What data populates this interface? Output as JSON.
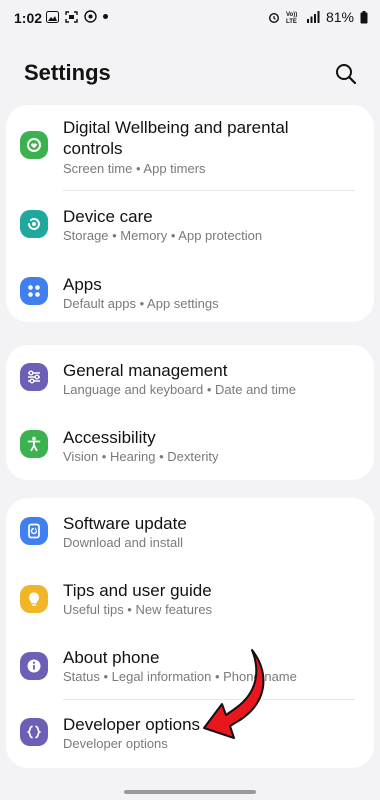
{
  "status_bar": {
    "time": "1:02",
    "battery": "81%",
    "network_label": "Vo))\nLTE"
  },
  "header": {
    "title": "Settings"
  },
  "groups": [
    {
      "items": [
        {
          "title": "Digital Wellbeing and parental controls",
          "subtitle": "Screen time  •  App timers",
          "icon": "wellbeing-icon",
          "color": "#3bb24f"
        },
        {
          "title": "Device care",
          "subtitle": "Storage  •  Memory  •  App protection",
          "icon": "device-care-icon",
          "color": "#1fa89d"
        },
        {
          "title": "Apps",
          "subtitle": "Default apps  •  App settings",
          "icon": "apps-icon",
          "color": "#3f7ff0"
        }
      ]
    },
    {
      "items": [
        {
          "title": "General management",
          "subtitle": "Language and keyboard  •  Date and time",
          "icon": "sliders-icon",
          "color": "#6d5fb5"
        },
        {
          "title": "Accessibility",
          "subtitle": "Vision  •  Hearing  •  Dexterity",
          "icon": "accessibility-icon",
          "color": "#3bb24f"
        }
      ]
    },
    {
      "items": [
        {
          "title": "Software update",
          "subtitle": "Download and install",
          "icon": "software-update-icon",
          "color": "#3f7ff0"
        },
        {
          "title": "Tips and user guide",
          "subtitle": "Useful tips  •  New features",
          "icon": "lightbulb-icon",
          "color": "#f0b628"
        },
        {
          "title": "About phone",
          "subtitle": "Status  •  Legal information  •  Phone name",
          "icon": "info-icon",
          "color": "#6d5fb5"
        },
        {
          "title": "Developer options",
          "subtitle": "Developer options",
          "icon": "braces-icon",
          "color": "#6d5fb5"
        }
      ]
    }
  ],
  "annotation": {
    "color": "#e8161d"
  }
}
